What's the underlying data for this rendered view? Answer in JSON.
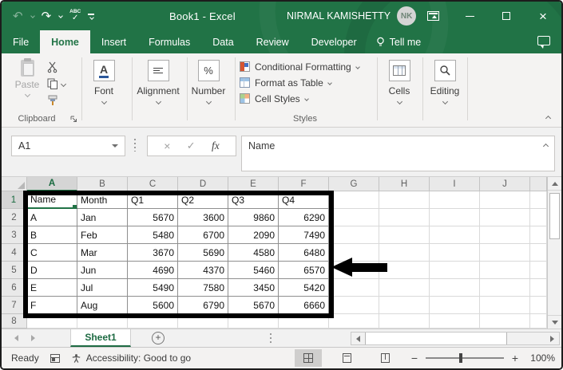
{
  "title_bar": {
    "workbook_title": "Book1 - Excel",
    "user_name": "NIRMAL KAMISHETTY",
    "user_initials": "NK"
  },
  "icons": {
    "undo": "↶",
    "redo": "↷",
    "abc": "ABC",
    "check": "✓",
    "cancel": "×",
    "close": "×",
    "fx": "fx",
    "font_a": "A",
    "percent": "%",
    "plus": "+",
    "minus": "−"
  },
  "ribbon_tabs": [
    "File",
    "Home",
    "Insert",
    "Formulas",
    "Data",
    "Review",
    "Developer"
  ],
  "tell_me": "Tell me",
  "ribbon": {
    "paste_label": "Paste",
    "clipboard_group": "Clipboard",
    "font_group": "Font",
    "alignment_group": "Alignment",
    "number_group": "Number",
    "styles_buttons": [
      "Conditional Formatting",
      "Format as Table",
      "Cell Styles"
    ],
    "styles_group": "Styles",
    "cells_label": "Cells",
    "editing_label": "Editing"
  },
  "formula_bar": {
    "name_box": "A1",
    "value": "Name"
  },
  "grid": {
    "selected_cell": "A1",
    "column_headers": [
      "A",
      "B",
      "C",
      "D",
      "E",
      "F",
      "G",
      "H",
      "I",
      "J"
    ],
    "row_headers": [
      "1",
      "2",
      "3",
      "4",
      "5",
      "6",
      "7",
      "8"
    ],
    "table": {
      "headers": [
        "Name",
        "Month",
        "Q1",
        "Q2",
        "Q3",
        "Q4"
      ],
      "rows": [
        [
          "A",
          "Jan",
          "5670",
          "3600",
          "9860",
          "6290"
        ],
        [
          "B",
          "Feb",
          "5480",
          "6700",
          "2090",
          "7490"
        ],
        [
          "C",
          "Mar",
          "3670",
          "5690",
          "4580",
          "6480"
        ],
        [
          "D",
          "Jun",
          "4690",
          "4370",
          "5460",
          "6570"
        ],
        [
          "E",
          "Jul",
          "5490",
          "7580",
          "3450",
          "5420"
        ],
        [
          "F",
          "Aug",
          "5600",
          "6790",
          "5670",
          "6660"
        ]
      ]
    }
  },
  "sheet_bar": {
    "tabs": [
      "Sheet1"
    ]
  },
  "status_bar": {
    "mode": "Ready",
    "accessibility": "Accessibility: Good to go",
    "zoom_level": "100%"
  },
  "colors": {
    "excel_green": "#217346",
    "selection_green": "#1e6b43",
    "annotation_black": "#000000"
  }
}
